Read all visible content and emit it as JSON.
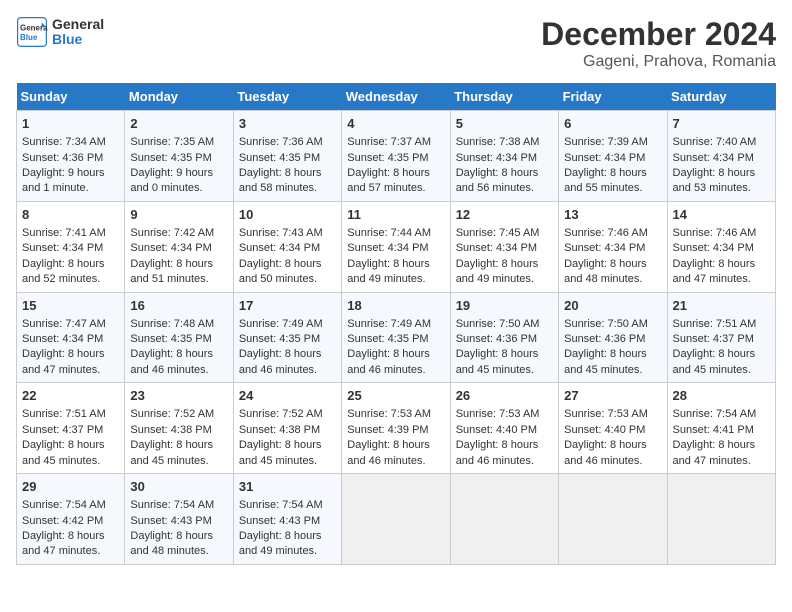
{
  "header": {
    "logo_line1": "General",
    "logo_line2": "Blue",
    "main_title": "December 2024",
    "sub_title": "Gageni, Prahova, Romania"
  },
  "days_of_week": [
    "Sunday",
    "Monday",
    "Tuesday",
    "Wednesday",
    "Thursday",
    "Friday",
    "Saturday"
  ],
  "weeks": [
    [
      {
        "day": "1",
        "lines": [
          "Sunrise: 7:34 AM",
          "Sunset: 4:36 PM",
          "Daylight: 9 hours",
          "and 1 minute."
        ]
      },
      {
        "day": "2",
        "lines": [
          "Sunrise: 7:35 AM",
          "Sunset: 4:35 PM",
          "Daylight: 9 hours",
          "and 0 minutes."
        ]
      },
      {
        "day": "3",
        "lines": [
          "Sunrise: 7:36 AM",
          "Sunset: 4:35 PM",
          "Daylight: 8 hours",
          "and 58 minutes."
        ]
      },
      {
        "day": "4",
        "lines": [
          "Sunrise: 7:37 AM",
          "Sunset: 4:35 PM",
          "Daylight: 8 hours",
          "and 57 minutes."
        ]
      },
      {
        "day": "5",
        "lines": [
          "Sunrise: 7:38 AM",
          "Sunset: 4:34 PM",
          "Daylight: 8 hours",
          "and 56 minutes."
        ]
      },
      {
        "day": "6",
        "lines": [
          "Sunrise: 7:39 AM",
          "Sunset: 4:34 PM",
          "Daylight: 8 hours",
          "and 55 minutes."
        ]
      },
      {
        "day": "7",
        "lines": [
          "Sunrise: 7:40 AM",
          "Sunset: 4:34 PM",
          "Daylight: 8 hours",
          "and 53 minutes."
        ]
      }
    ],
    [
      {
        "day": "8",
        "lines": [
          "Sunrise: 7:41 AM",
          "Sunset: 4:34 PM",
          "Daylight: 8 hours",
          "and 52 minutes."
        ]
      },
      {
        "day": "9",
        "lines": [
          "Sunrise: 7:42 AM",
          "Sunset: 4:34 PM",
          "Daylight: 8 hours",
          "and 51 minutes."
        ]
      },
      {
        "day": "10",
        "lines": [
          "Sunrise: 7:43 AM",
          "Sunset: 4:34 PM",
          "Daylight: 8 hours",
          "and 50 minutes."
        ]
      },
      {
        "day": "11",
        "lines": [
          "Sunrise: 7:44 AM",
          "Sunset: 4:34 PM",
          "Daylight: 8 hours",
          "and 49 minutes."
        ]
      },
      {
        "day": "12",
        "lines": [
          "Sunrise: 7:45 AM",
          "Sunset: 4:34 PM",
          "Daylight: 8 hours",
          "and 49 minutes."
        ]
      },
      {
        "day": "13",
        "lines": [
          "Sunrise: 7:46 AM",
          "Sunset: 4:34 PM",
          "Daylight: 8 hours",
          "and 48 minutes."
        ]
      },
      {
        "day": "14",
        "lines": [
          "Sunrise: 7:46 AM",
          "Sunset: 4:34 PM",
          "Daylight: 8 hours",
          "and 47 minutes."
        ]
      }
    ],
    [
      {
        "day": "15",
        "lines": [
          "Sunrise: 7:47 AM",
          "Sunset: 4:34 PM",
          "Daylight: 8 hours",
          "and 47 minutes."
        ]
      },
      {
        "day": "16",
        "lines": [
          "Sunrise: 7:48 AM",
          "Sunset: 4:35 PM",
          "Daylight: 8 hours",
          "and 46 minutes."
        ]
      },
      {
        "day": "17",
        "lines": [
          "Sunrise: 7:49 AM",
          "Sunset: 4:35 PM",
          "Daylight: 8 hours",
          "and 46 minutes."
        ]
      },
      {
        "day": "18",
        "lines": [
          "Sunrise: 7:49 AM",
          "Sunset: 4:35 PM",
          "Daylight: 8 hours",
          "and 46 minutes."
        ]
      },
      {
        "day": "19",
        "lines": [
          "Sunrise: 7:50 AM",
          "Sunset: 4:36 PM",
          "Daylight: 8 hours",
          "and 45 minutes."
        ]
      },
      {
        "day": "20",
        "lines": [
          "Sunrise: 7:50 AM",
          "Sunset: 4:36 PM",
          "Daylight: 8 hours",
          "and 45 minutes."
        ]
      },
      {
        "day": "21",
        "lines": [
          "Sunrise: 7:51 AM",
          "Sunset: 4:37 PM",
          "Daylight: 8 hours",
          "and 45 minutes."
        ]
      }
    ],
    [
      {
        "day": "22",
        "lines": [
          "Sunrise: 7:51 AM",
          "Sunset: 4:37 PM",
          "Daylight: 8 hours",
          "and 45 minutes."
        ]
      },
      {
        "day": "23",
        "lines": [
          "Sunrise: 7:52 AM",
          "Sunset: 4:38 PM",
          "Daylight: 8 hours",
          "and 45 minutes."
        ]
      },
      {
        "day": "24",
        "lines": [
          "Sunrise: 7:52 AM",
          "Sunset: 4:38 PM",
          "Daylight: 8 hours",
          "and 45 minutes."
        ]
      },
      {
        "day": "25",
        "lines": [
          "Sunrise: 7:53 AM",
          "Sunset: 4:39 PM",
          "Daylight: 8 hours",
          "and 46 minutes."
        ]
      },
      {
        "day": "26",
        "lines": [
          "Sunrise: 7:53 AM",
          "Sunset: 4:40 PM",
          "Daylight: 8 hours",
          "and 46 minutes."
        ]
      },
      {
        "day": "27",
        "lines": [
          "Sunrise: 7:53 AM",
          "Sunset: 4:40 PM",
          "Daylight: 8 hours",
          "and 46 minutes."
        ]
      },
      {
        "day": "28",
        "lines": [
          "Sunrise: 7:54 AM",
          "Sunset: 4:41 PM",
          "Daylight: 8 hours",
          "and 47 minutes."
        ]
      }
    ],
    [
      {
        "day": "29",
        "lines": [
          "Sunrise: 7:54 AM",
          "Sunset: 4:42 PM",
          "Daylight: 8 hours",
          "and 47 minutes."
        ]
      },
      {
        "day": "30",
        "lines": [
          "Sunrise: 7:54 AM",
          "Sunset: 4:43 PM",
          "Daylight: 8 hours",
          "and 48 minutes."
        ]
      },
      {
        "day": "31",
        "lines": [
          "Sunrise: 7:54 AM",
          "Sunset: 4:43 PM",
          "Daylight: 8 hours",
          "and 49 minutes."
        ]
      },
      null,
      null,
      null,
      null
    ]
  ]
}
